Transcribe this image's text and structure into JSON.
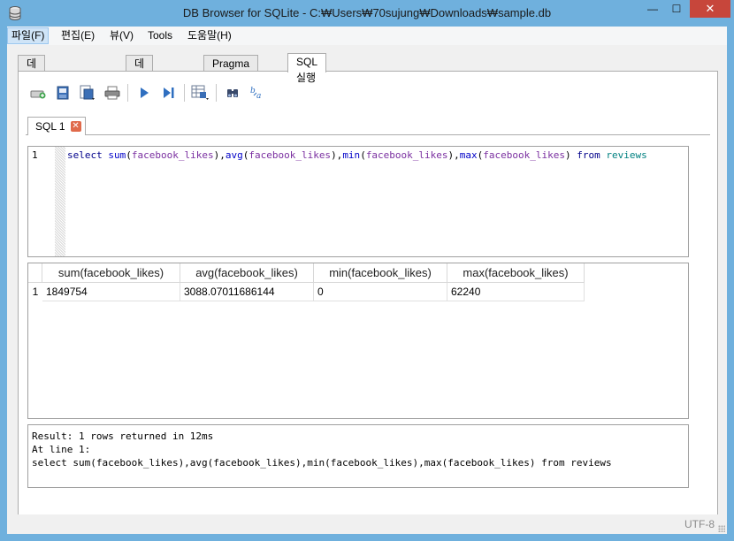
{
  "window": {
    "title": "DB Browser for SQLite - C:₩Users₩70sujung₩Downloads₩sample.db",
    "min": "—",
    "max": "☐",
    "close": "✕"
  },
  "menu": [
    {
      "label": "파일(F)"
    },
    {
      "label": "편집(E)"
    },
    {
      "label": "뷰(V)"
    },
    {
      "label": "Tools"
    },
    {
      "label": "도움말(H)"
    }
  ],
  "tabs": [
    {
      "label": "데이터베이스 구조"
    },
    {
      "label": "데이터 보기"
    },
    {
      "label": "Pragma 수정"
    },
    {
      "label": "SQL 실행"
    }
  ],
  "toolbar": {
    "icons": [
      "open-tab-icon",
      "open-sql-icon",
      "save-sql-icon",
      "print-icon",
      "execute-all-icon",
      "execute-line-icon",
      "save-results-icon",
      "find-icon",
      "find-replace-icon"
    ]
  },
  "sql_tab": {
    "label": "SQL 1",
    "close": "✕"
  },
  "editor": {
    "line_number": "1",
    "tokens": [
      {
        "t": "select",
        "c": "kw"
      },
      {
        "t": " ",
        "c": ""
      },
      {
        "t": "sum",
        "c": "fn"
      },
      {
        "t": "(",
        "c": ""
      },
      {
        "t": "facebook_likes",
        "c": "id"
      },
      {
        "t": "),",
        "c": ""
      },
      {
        "t": "avg",
        "c": "fn"
      },
      {
        "t": "(",
        "c": ""
      },
      {
        "t": "facebook_likes",
        "c": "id"
      },
      {
        "t": "),",
        "c": ""
      },
      {
        "t": "min",
        "c": "fn"
      },
      {
        "t": "(",
        "c": ""
      },
      {
        "t": "facebook_likes",
        "c": "id"
      },
      {
        "t": "),",
        "c": ""
      },
      {
        "t": "max",
        "c": "fn"
      },
      {
        "t": "(",
        "c": ""
      },
      {
        "t": "facebook_likes",
        "c": "id"
      },
      {
        "t": ") ",
        "c": ""
      },
      {
        "t": "from",
        "c": "kw"
      },
      {
        "t": " ",
        "c": ""
      },
      {
        "t": "reviews",
        "c": "tbl"
      }
    ]
  },
  "results": {
    "columns": [
      "sum(facebook_likes)",
      "avg(facebook_likes)",
      "min(facebook_likes)",
      "max(facebook_likes)"
    ],
    "rows": [
      {
        "row_number": "1",
        "values": [
          "1849754",
          "3088.07011686144",
          "0",
          "62240"
        ]
      }
    ]
  },
  "messages": [
    "Result: 1 rows returned in 12ms",
    "At line 1:",
    "select sum(facebook_likes),avg(facebook_likes),min(facebook_likes),max(facebook_likes) from reviews"
  ],
  "status": {
    "encoding": "UTF-8"
  },
  "colors": {
    "titlebar": "#6fb0dd",
    "close_button": "#c7463b",
    "keyword": "#00008b",
    "function": "#0000c8",
    "identifier": "#7a2fa0",
    "table": "#008080"
  }
}
